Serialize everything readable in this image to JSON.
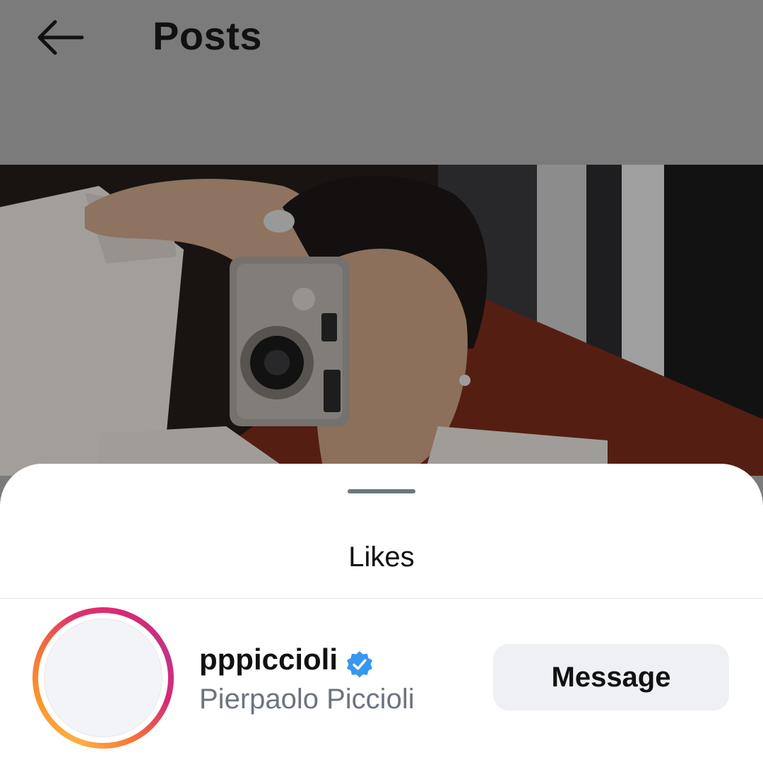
{
  "header": {
    "title": "Posts",
    "back_icon": "arrow-left-icon"
  },
  "sheet": {
    "title": "Likes"
  },
  "likes": [
    {
      "username": "pppiccioli",
      "full_name": "Pierpaolo Piccioli",
      "verified": true,
      "action_label": "Message"
    }
  ],
  "colors": {
    "verified_badge": "#3897f0",
    "secondary_text": "#6d7480",
    "button_bg": "#eef0f4"
  }
}
